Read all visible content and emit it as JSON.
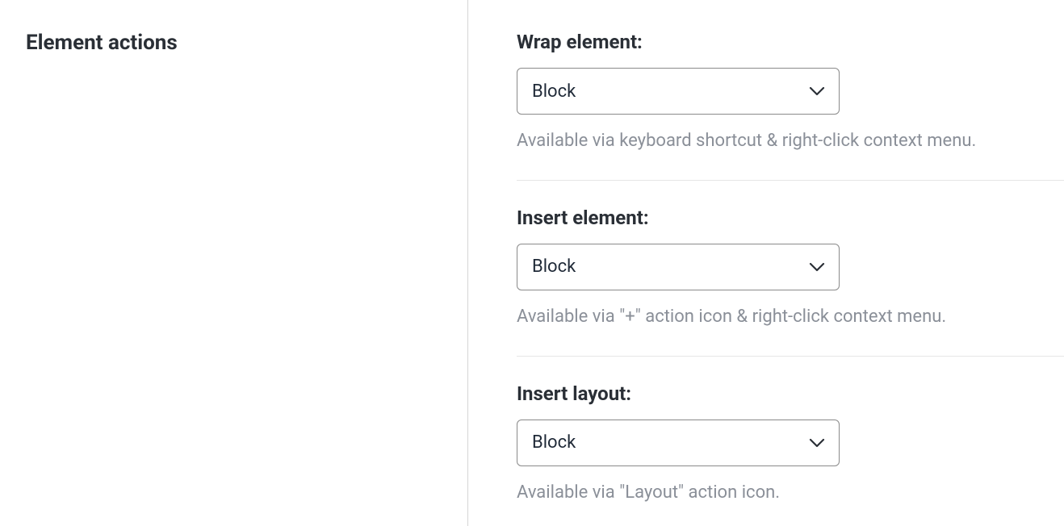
{
  "sidebar": {
    "title": "Element actions"
  },
  "fields": {
    "wrap": {
      "label": "Wrap element:",
      "value": "Block",
      "helper": "Available via keyboard shortcut & right-click context menu."
    },
    "insertElement": {
      "label": "Insert element:",
      "value": "Block",
      "helper": "Available via \"+\" action icon & right-click context menu."
    },
    "insertLayout": {
      "label": "Insert layout:",
      "value": "Block",
      "helper": "Available via \"Layout\" action icon."
    }
  }
}
